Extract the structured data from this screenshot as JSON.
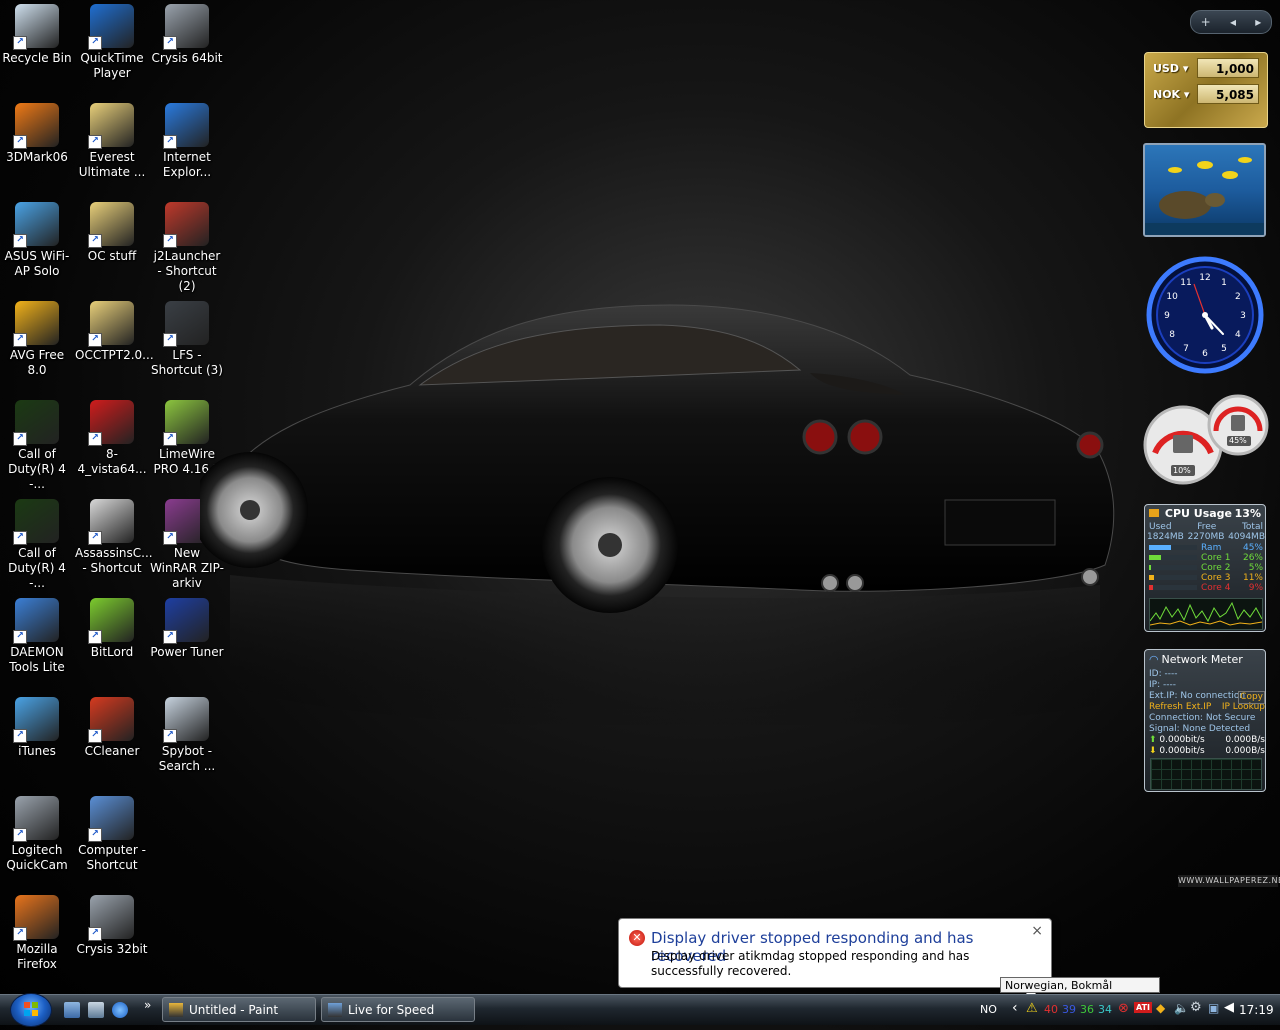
{
  "desktop_icons": [
    {
      "label": "Recycle Bin",
      "icon": "recycle-bin-icon",
      "color": "#cfe0ee"
    },
    {
      "label": "QuickTime Player",
      "icon": "quicktime-icon",
      "color": "#1f6fd2"
    },
    {
      "label": "Crysis 64bit",
      "icon": "crysis-icon",
      "color": "#9aa3ad"
    },
    {
      "label": "3DMark06",
      "icon": "3dmark-icon",
      "color": "#f07a16"
    },
    {
      "label": "Everest Ultimate ...",
      "icon": "folder-icon",
      "color": "#e9d07a"
    },
    {
      "label": "Internet Explor...",
      "icon": "internet-explorer-icon",
      "color": "#2a7be0"
    },
    {
      "label": "ASUS WiFi-AP Solo",
      "icon": "asus-wifi-icon",
      "color": "#4aa3e6"
    },
    {
      "label": "OC stuff",
      "icon": "folder-icon",
      "color": "#e9d07a"
    },
    {
      "label": "j2Launcher - Shortcut (2)",
      "icon": "j2launcher-icon",
      "color": "#c0392b"
    },
    {
      "label": "AVG Free 8.0",
      "icon": "avg-icon",
      "color": "#f2b21a"
    },
    {
      "label": "OCCTPT2.0...",
      "icon": "folder-icon",
      "color": "#e9d07a"
    },
    {
      "label": "LFS - Shortcut (3)",
      "icon": "lfs-icon",
      "color": "#3a3f45"
    },
    {
      "label": "Call of Duty(R) 4 -...",
      "icon": "cod4-icon",
      "color": "#1b3a13"
    },
    {
      "label": "8-4_vista64...",
      "icon": "ati-radeon-icon",
      "color": "#d01c1c"
    },
    {
      "label": "LimeWire PRO 4.16.2",
      "icon": "limewire-icon",
      "color": "#8cc63f"
    },
    {
      "label": "Call of Duty(R) 4 -...",
      "icon": "cod4-icon",
      "color": "#1b3a13"
    },
    {
      "label": "AssassinsC... - Shortcut",
      "icon": "assassins-creed-icon",
      "color": "#d9d9d9"
    },
    {
      "label": "New WinRAR ZIP-arkiv",
      "icon": "winrar-icon",
      "color": "#8a3c8f"
    },
    {
      "label": "DAEMON Tools Lite",
      "icon": "daemon-tools-icon",
      "color": "#3b7fd6"
    },
    {
      "label": "BitLord",
      "icon": "bitlord-icon",
      "color": "#7ccc2e"
    },
    {
      "label": "Power Tuner",
      "icon": "power-tuner-icon",
      "color": "#1e3fa3"
    },
    {
      "label": "iTunes",
      "icon": "itunes-icon",
      "color": "#4aa3e6"
    },
    {
      "label": "CCleaner",
      "icon": "ccleaner-icon",
      "color": "#d63a1f"
    },
    {
      "label": "Spybot - Search ...",
      "icon": "spybot-icon",
      "color": "#c7d3df"
    },
    {
      "label": "Logitech QuickCam",
      "icon": "webcam-icon",
      "color": "#9aa3ad"
    },
    {
      "label": "Computer - Shortcut",
      "icon": "computer-icon",
      "color": "#5a8fd6"
    },
    {
      "label": "Mozilla Firefox",
      "icon": "firefox-icon",
      "color": "#e8741c"
    },
    {
      "label": "Crysis 32bit",
      "icon": "crysis-icon",
      "color": "#9aa3ad"
    }
  ],
  "sidebar_controls": {
    "add": "+",
    "prev": "◂",
    "next": "▸"
  },
  "currency": {
    "rows": [
      {
        "code": "USD",
        "value": "1,000"
      },
      {
        "code": "NOK",
        "value": "5,085"
      }
    ]
  },
  "meters": {
    "cpu_pct": "10%",
    "ram_pct": "45%",
    "cpu_value": 0.1,
    "ram_value": 0.45
  },
  "cpu_gadget": {
    "title": "CPU Usage",
    "percent": "13%",
    "headers": [
      "Used",
      "Free",
      "Total"
    ],
    "values": [
      "1824MB",
      "2270MB",
      "4094MB"
    ],
    "rows": [
      {
        "label": "Ram",
        "value": "45%",
        "level": 0.45,
        "color": "#5ab0ff"
      },
      {
        "label": "Core 1",
        "value": "26%",
        "level": 0.26,
        "color": "#6fdc3a"
      },
      {
        "label": "Core 2",
        "value": "5%",
        "level": 0.05,
        "color": "#6fdc3a"
      },
      {
        "label": "Core 3",
        "value": "11%",
        "level": 0.11,
        "color": "#f2b21a"
      },
      {
        "label": "Core 4",
        "value": "9%",
        "level": 0.09,
        "color": "#e23030"
      }
    ]
  },
  "network_gadget": {
    "title": "Network Meter",
    "id": "ID: ----",
    "ip": "IP: ----",
    "ext_ip": "Ext.IP: No connection",
    "copy": "Copy",
    "refresh": "Refresh Ext.IP",
    "lookup": "IP Lookup",
    "connection": "Connection: Not Secure",
    "signal": "Signal: None Detected",
    "up_bits": "0.000bit/s",
    "up_bytes": "0.000B/s",
    "down_bits": "0.000bit/s",
    "down_bytes": "0.000B/s"
  },
  "watermark": "WWW.WALLPAPEREZ.NET",
  "notification": {
    "title": "Display driver stopped responding and has recovered",
    "message": "Display driver atikmdag stopped responding and has successfully recovered.",
    "close": "×"
  },
  "tooltip": "Norwegian, Bokmål (Norway)",
  "taskbar": {
    "overflow": "»",
    "tasks": [
      {
        "label": "Untitled - Paint",
        "color": "#e7b63c"
      },
      {
        "label": "Live for Speed",
        "color": "#6fa0d8"
      }
    ],
    "language": "NO",
    "tray_chevron": "‹",
    "temps": [
      {
        "value": "40",
        "color": "#e23030"
      },
      {
        "value": "39",
        "color": "#3a58e2"
      },
      {
        "value": "36",
        "color": "#3ec83a"
      },
      {
        "value": "34",
        "color": "#3ac8c8"
      }
    ],
    "time": "17:19"
  }
}
